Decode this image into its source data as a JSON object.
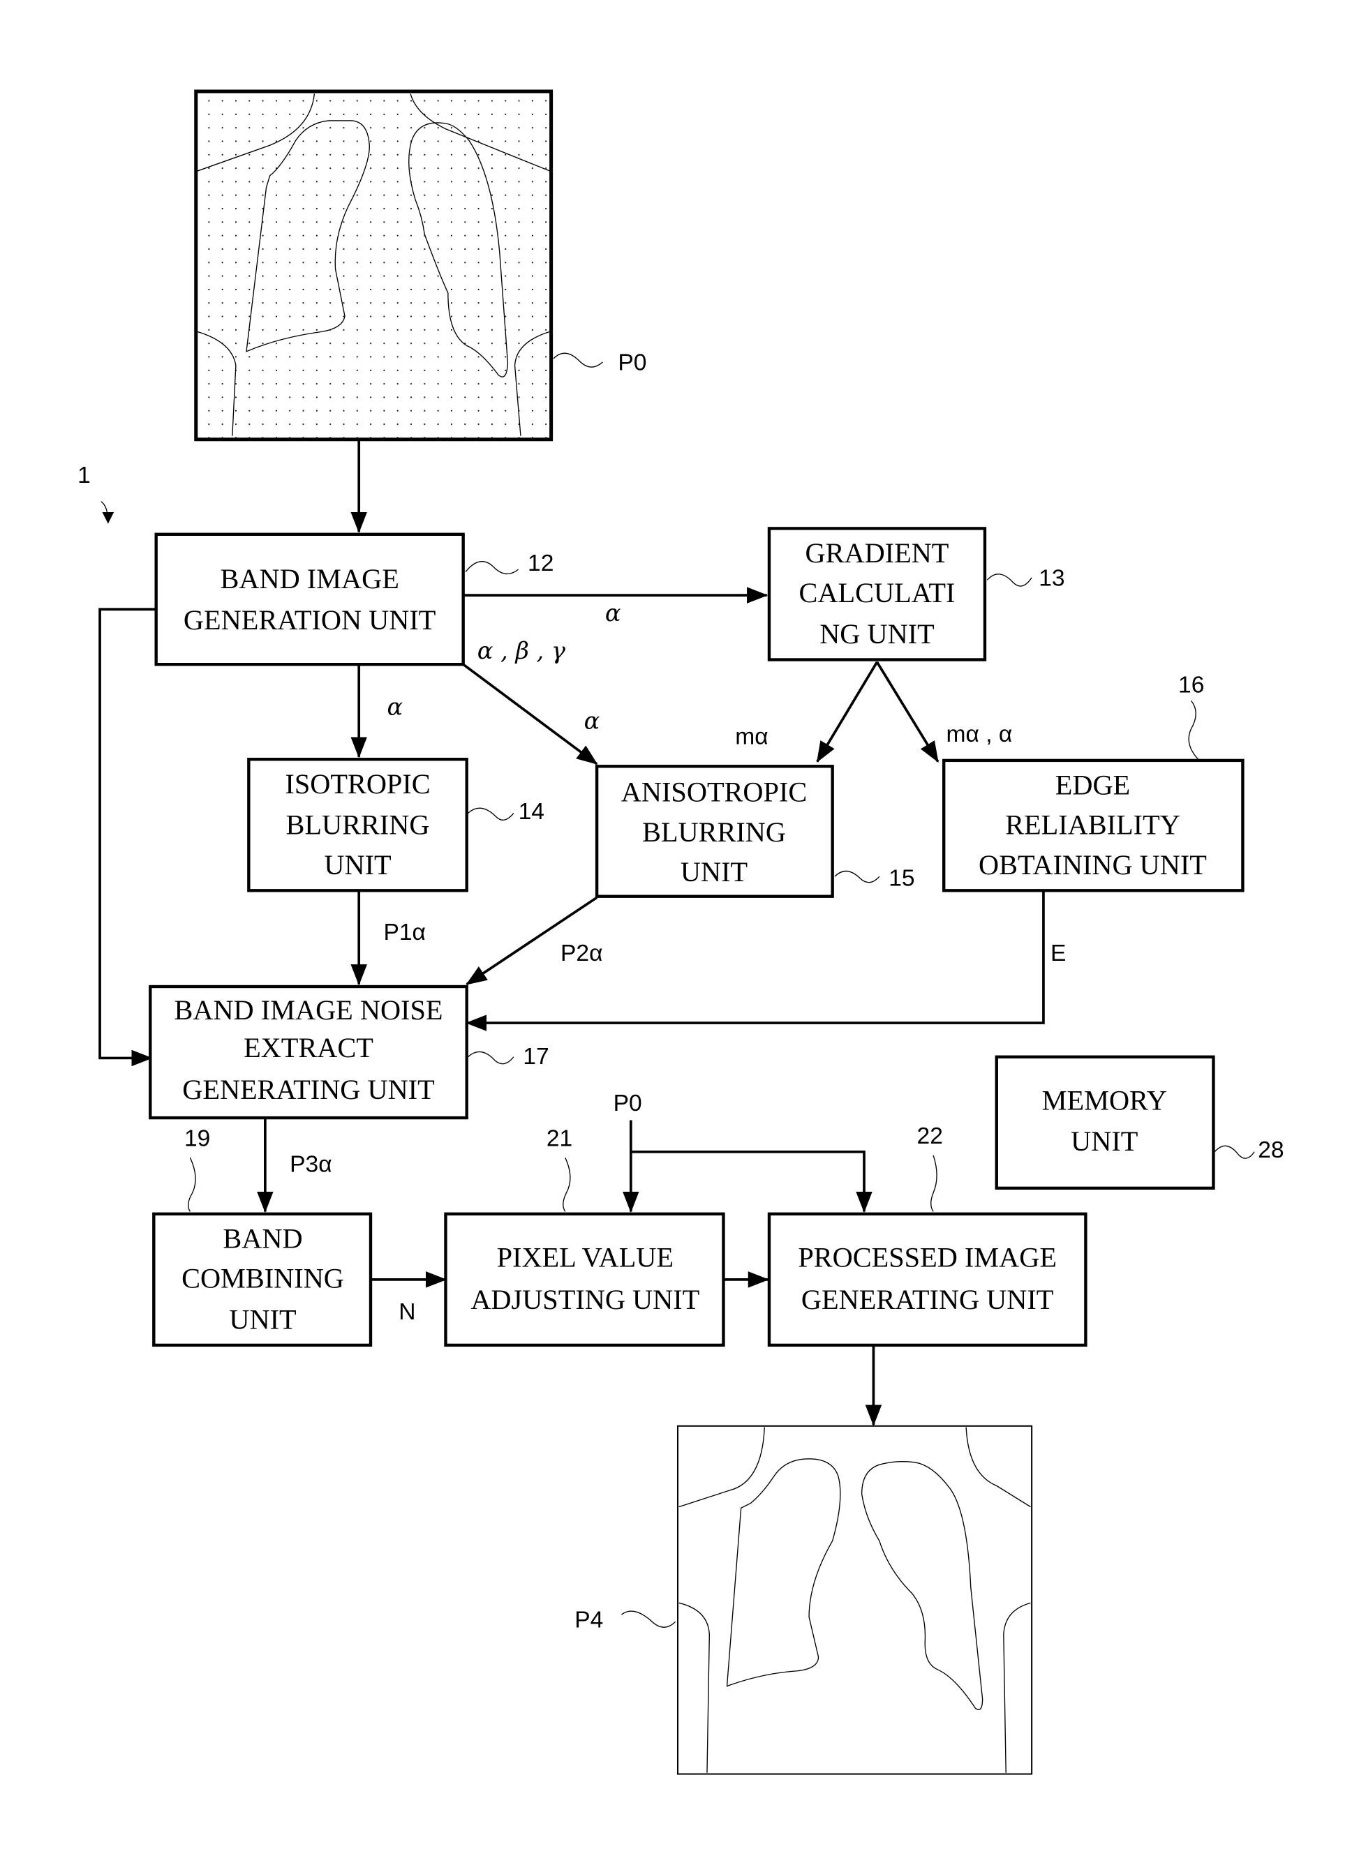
{
  "figure": {
    "system_ref": "1",
    "input_image": {
      "label": "P0"
    },
    "output_image": {
      "label": "P4"
    },
    "units": [
      {
        "id": "band_image_generation",
        "ref": "12",
        "lines": [
          "BAND IMAGE",
          "GENERATION UNIT"
        ]
      },
      {
        "id": "gradient_calculating",
        "ref": "13",
        "lines": [
          "GRADIENT",
          "CALCULATI",
          "NG UNIT"
        ]
      },
      {
        "id": "isotropic_blurring",
        "ref": "14",
        "lines": [
          "ISOTROPIC",
          "BLURRING",
          "UNIT"
        ]
      },
      {
        "id": "anisotropic_blurring",
        "ref": "15",
        "lines": [
          "ANISOTROPIC",
          "BLURRING",
          "UNIT"
        ]
      },
      {
        "id": "edge_reliability",
        "ref": "16",
        "lines": [
          "EDGE",
          "RELIABILITY",
          "OBTAINING UNIT"
        ]
      },
      {
        "id": "noise_extract",
        "ref": "17",
        "lines": [
          "BAND IMAGE NOISE",
          "EXTRACT",
          "GENERATING UNIT"
        ]
      },
      {
        "id": "band_combining",
        "ref": "19",
        "lines": [
          "BAND",
          "COMBINING",
          "UNIT"
        ]
      },
      {
        "id": "pixel_value_adjusting",
        "ref": "21",
        "lines": [
          "PIXEL VALUE",
          "ADJUSTING UNIT"
        ]
      },
      {
        "id": "processed_image_generating",
        "ref": "22",
        "lines": [
          "PROCESSED IMAGE",
          "GENERATING UNIT"
        ]
      },
      {
        "id": "memory",
        "ref": "28",
        "lines": [
          "MEMORY",
          "UNIT"
        ]
      }
    ],
    "signals": {
      "to_gradient": "α",
      "abg": "α , β , γ",
      "to_isotropic": "α",
      "to_anisotropic": "α",
      "grad_to_aniso": "mα",
      "grad_to_edge": "mα , α",
      "p1": "P1α",
      "p2": "P2α",
      "edge_out": "E",
      "p3": "P3α",
      "n": "N",
      "p0_in": "P0"
    }
  }
}
